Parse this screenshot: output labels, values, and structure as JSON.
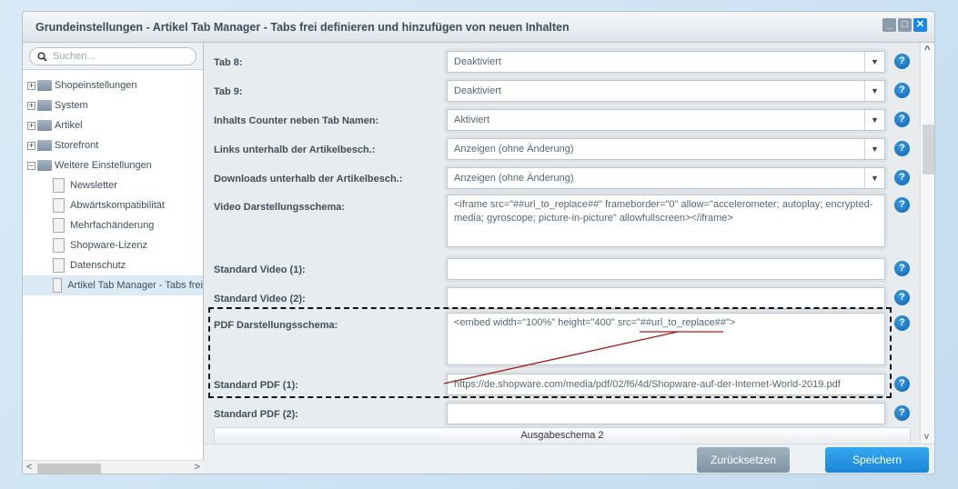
{
  "window": {
    "title": "Grundeinstellungen - Artikel Tab Manager - Tabs frei definieren und hinzufügen von neuen Inhalten",
    "min": "_",
    "max": "□",
    "close": "✕"
  },
  "sidebar": {
    "search_placeholder": "Suchen...",
    "items": [
      {
        "label": "Shopeinstellungen",
        "expand": "+"
      },
      {
        "label": "System",
        "expand": "+"
      },
      {
        "label": "Artikel",
        "expand": "+"
      },
      {
        "label": "Storefront",
        "expand": "+"
      },
      {
        "label": "Weitere Einstellungen",
        "expand": "−"
      }
    ],
    "children": [
      {
        "label": "Newsletter"
      },
      {
        "label": "Abwärtskompatibilität"
      },
      {
        "label": "Mehrfachänderung"
      },
      {
        "label": "Shopware-Lizenz"
      },
      {
        "label": "Datenschutz"
      },
      {
        "label": "Artikel Tab Manager - Tabs frei"
      }
    ],
    "scroll_left": "<",
    "scroll_right": ">"
  },
  "form": {
    "rows": [
      {
        "label": "Tab 8:",
        "value": "Deaktiviert",
        "type": "select"
      },
      {
        "label": "Tab 9:",
        "value": "Deaktiviert",
        "type": "select"
      },
      {
        "label": "Inhalts Counter neben Tab Namen:",
        "value": "Aktiviert",
        "type": "select"
      },
      {
        "label": "Links unterhalb der Artikelbesch.:",
        "value": "Anzeigen (ohne Änderung)",
        "type": "select"
      },
      {
        "label": "Downloads unterhalb der Artikelbesch.:",
        "value": "Anzeigen (ohne Änderung)",
        "type": "select"
      },
      {
        "label": "Video Darstellungsschema:",
        "value": "<iframe src=\"##url_to_replace##\" frameborder=\"0\" allow=\"accelerometer; autoplay; encrypted-media; gyroscope; picture-in-picture\" allowfullscreen></iframe>",
        "type": "textarea"
      },
      {
        "label": "Standard Video (1):",
        "value": "",
        "type": "text"
      },
      {
        "label": "Standard Video (2):",
        "value": "",
        "type": "text"
      },
      {
        "label": "PDF Darstellungsschema:",
        "value": "<embed width=\"100%\" height=\"400\" src=\"##url_to_replace##\">",
        "type": "textarea"
      },
      {
        "label": "Standard PDF (1):",
        "value": "https://de.shopware.com/media/pdf/02/f6/4d/Shopware-auf-der-Internet-World-2019.pdf",
        "type": "text"
      },
      {
        "label": "Standard PDF (2):",
        "value": "",
        "type": "text"
      }
    ],
    "section": "Ausgabeschema 2",
    "help": "?",
    "dropdown_arrow": "▼"
  },
  "scroll": {
    "up": "^",
    "down": "v"
  },
  "buttons": {
    "reset": "Zurücksetzen",
    "save": "Speichern"
  },
  "colors": {
    "save": "#1e8fe0",
    "reset": "#8fa3b1",
    "annotation": "#a01c1c"
  }
}
